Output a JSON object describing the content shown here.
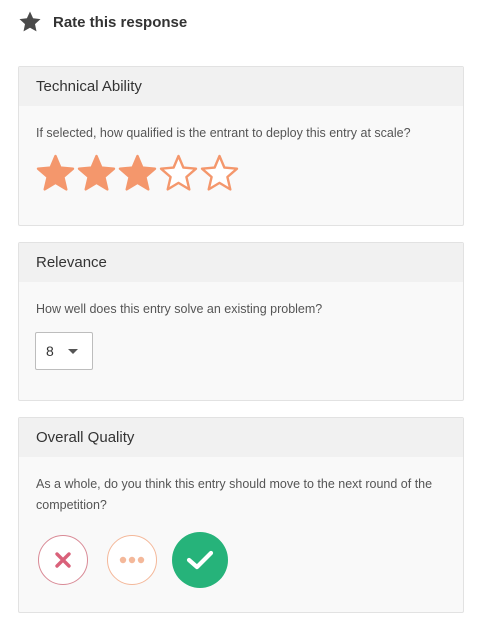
{
  "header": {
    "title": "Rate this response",
    "icon": "star-icon"
  },
  "technical": {
    "title": "Technical Ability",
    "question": "If selected, how qualified is the entrant to deploy this entry at scale?",
    "rating": 3,
    "max_rating": 5,
    "star_color": "#f4976c"
  },
  "relevance": {
    "title": "Relevance",
    "question": "How well does this entry solve an existing problem?",
    "selected": "8"
  },
  "overall": {
    "title": "Overall Quality",
    "question": "As a whole, do you think this entry should move to the next round of the competition?",
    "choices": [
      {
        "icon": "x-icon",
        "color": "#d9617a",
        "selected": false
      },
      {
        "icon": "ellipsis-icon",
        "color": "#f4b89a",
        "selected": false
      },
      {
        "icon": "checkmark-icon",
        "color": "#26b37a",
        "selected": true
      }
    ]
  }
}
